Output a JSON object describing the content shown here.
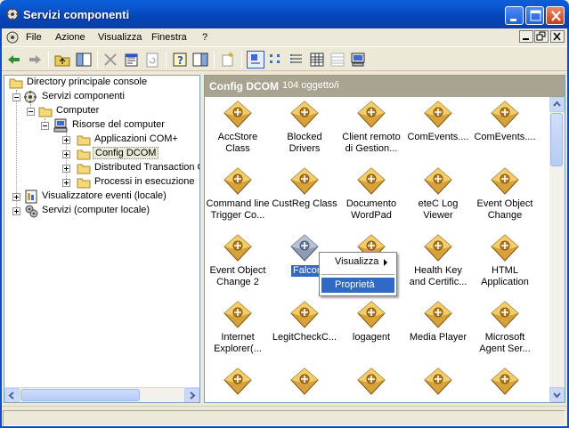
{
  "window": {
    "title": "Servizi componenti"
  },
  "menubar": {
    "items": [
      "File",
      "Azione",
      "Visualizza",
      "Finestra",
      "?"
    ]
  },
  "tree": {
    "items": [
      {
        "label": "Directory principale console",
        "icon": "folder-icon"
      },
      {
        "label": "Servizi componenti",
        "icon": "component-services-icon"
      },
      {
        "label": "Computer",
        "icon": "folder-icon"
      },
      {
        "label": "Risorse del computer",
        "icon": "computer-icon"
      },
      {
        "label": "Applicazioni COM+",
        "icon": "folder-icon"
      },
      {
        "label": "Config DCOM",
        "icon": "folder-icon"
      },
      {
        "label": "Distributed Transaction C",
        "icon": "folder-icon"
      },
      {
        "label": "Processi in esecuzione",
        "icon": "folder-icon"
      },
      {
        "label": "Visualizzatore eventi (locale)",
        "icon": "event-viewer-icon"
      },
      {
        "label": "Servizi (computer locale)",
        "icon": "services-gear-icon"
      }
    ]
  },
  "pane": {
    "title": "Config DCOM",
    "count": "104 oggetto/i"
  },
  "icons": [
    "AccStore Class",
    "Blocked\nDrivers",
    "Client remoto\ndi Gestion...",
    "ComEvents....",
    "ComEvents....",
    "Command line\nTrigger Co...",
    "CustReg Class",
    "Documento\nWordPad",
    "eteC Log\nViewer",
    "Event Object\nChange",
    "Event Object\nChange 2",
    "Falcon",
    "",
    "Health Key\nand Certific...",
    "HTML\nApplication",
    "Internet\nExplorer(...",
    "LegitCheckC...",
    "logagent",
    "Media Player",
    "Microsoft\nAgent Ser...",
    "",
    "",
    "",
    "",
    ""
  ],
  "context_menu": {
    "items": [
      "Visualizza",
      "Proprietà"
    ]
  },
  "colors": {
    "titlebar": "#0a5fd8",
    "selection": "#316ac5",
    "header": "#a9a491"
  }
}
